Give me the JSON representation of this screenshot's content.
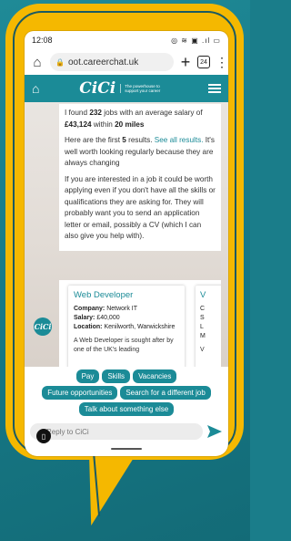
{
  "status_bar": {
    "time": "12:08",
    "icons": "◎ ≋ ▣ .ıl ▭"
  },
  "browser": {
    "url": "oot.careerchat.uk",
    "tab_count": "24"
  },
  "site": {
    "logo": "CiCi",
    "tagline": "The powerhouse to support your career"
  },
  "message": {
    "p1_pre": "I found ",
    "jobs_count": "232",
    "p1_mid": " jobs with an average salary of ",
    "avg_salary": "£43,124",
    "p1_mid2": " within ",
    "distance": "20 miles",
    "p2_pre": "Here are the first ",
    "first_count": "5",
    "p2_mid": " results. ",
    "see_all": "See all results.",
    "p2_post": " It's well worth looking regularly because they are always changing",
    "p3": "If you are interested in a job it could be worth applying even if you don't have all the skills or qualifications they are asking for. They will probably want you to send an application letter or email, possibly a CV (which I can also give you help with)."
  },
  "avatar_label": "CiCi",
  "job_card": {
    "title": "Web Developer",
    "company_label": "Company:",
    "company": "Network IT",
    "salary_label": "Salary:",
    "salary": "£40,000",
    "location_label": "Location:",
    "location": "Kenilworth, Warwickshire",
    "description": "A Web Developer is sought after by one of the UK's leading"
  },
  "job_card2": {
    "title": "V",
    "line1": "C",
    "line2": "S",
    "line3": "L",
    "line4": "M",
    "line5": "V"
  },
  "quick_replies": {
    "row1": [
      "Pay",
      "Skills",
      "Vacancies"
    ],
    "row2": [
      "Future opportunities",
      "Search for a different job"
    ],
    "row3": [
      "Talk about something else"
    ]
  },
  "input": {
    "placeholder": "Reply to CiCi"
  },
  "colors": {
    "background": "#1a7d8a",
    "bubble": "#f5b800",
    "brand": "#1b8b97"
  }
}
